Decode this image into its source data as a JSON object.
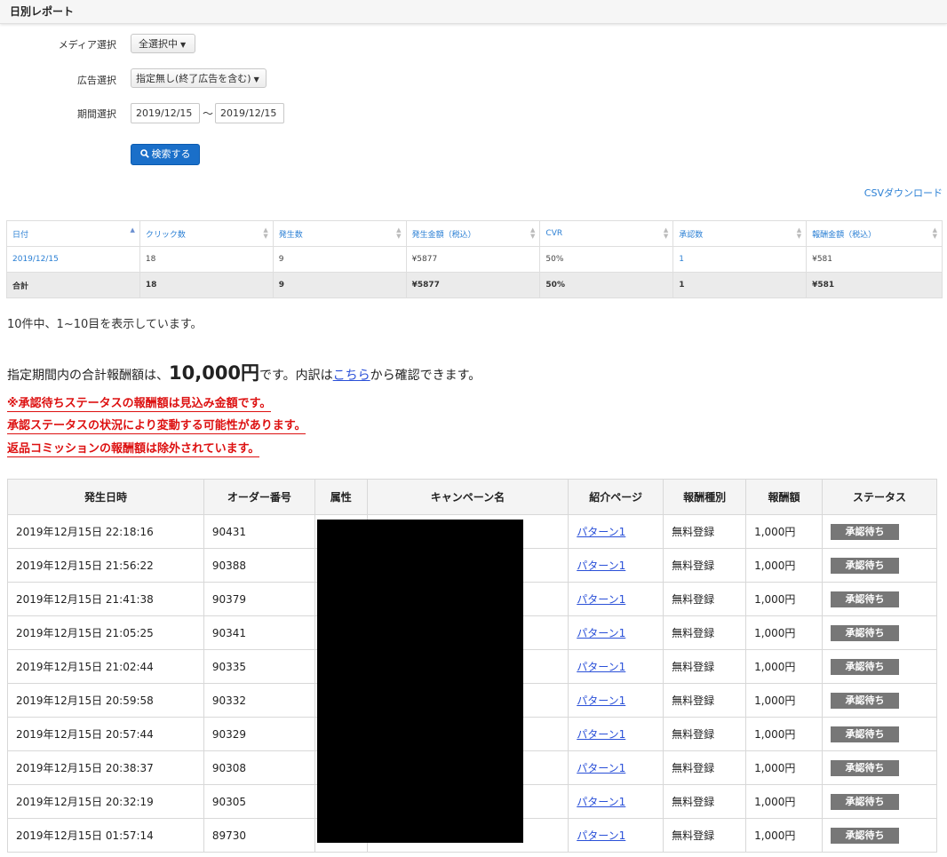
{
  "header": {
    "title": "日別レポート"
  },
  "filters": {
    "media_label": "メディア選択",
    "media_value": "全選択中",
    "ad_label": "広告選択",
    "ad_value": "指定無し(終了広告を含む)",
    "period_label": "期間選択",
    "date_from": "2019/12/15",
    "date_separator": "〜",
    "date_to": "2019/12/15",
    "search_button": "検索する"
  },
  "csv_link": "CSVダウンロード",
  "summary_table": {
    "headers": [
      "日付",
      "クリック数",
      "発生数",
      "発生金額（税込）",
      "CVR",
      "承認数",
      "報酬金額（税込）"
    ],
    "rows": [
      [
        "2019/12/15",
        "18",
        "9",
        "¥5877",
        "50%",
        "1",
        "¥581"
      ]
    ],
    "total": [
      "合計",
      "18",
      "9",
      "¥5877",
      "50%",
      "1",
      "¥581"
    ]
  },
  "count_text": "10件中、1~10目を表示しています。",
  "total_text": {
    "prefix": "指定期間内の合計報酬額は、",
    "amount": "10,000円",
    "middle": "です。内訳は",
    "link": "こちら",
    "suffix": "から確認できます。"
  },
  "warnings": [
    "※承認待ちステータスの報酬額は見込み金額です。",
    "承認ステータスの状況により変動する可能性があります。",
    "返品コミッションの報酬額は除外されています。"
  ],
  "orders_table": {
    "headers": [
      "発生日時",
      "オーダー番号",
      "属性",
      "キャンペーン名",
      "紹介ページ",
      "報酬種別",
      "報酬額",
      "ステータス"
    ],
    "rows": [
      {
        "date": "2019年12月15日 22:18:16",
        "order": "90431",
        "page": "パターン1",
        "type": "無料登録",
        "amount": "1,000円",
        "status": "承認待ち"
      },
      {
        "date": "2019年12月15日 21:56:22",
        "order": "90388",
        "page": "パターン1",
        "type": "無料登録",
        "amount": "1,000円",
        "status": "承認待ち"
      },
      {
        "date": "2019年12月15日 21:41:38",
        "order": "90379",
        "page": "パターン1",
        "type": "無料登録",
        "amount": "1,000円",
        "status": "承認待ち"
      },
      {
        "date": "2019年12月15日 21:05:25",
        "order": "90341",
        "page": "パターン1",
        "type": "無料登録",
        "amount": "1,000円",
        "status": "承認待ち"
      },
      {
        "date": "2019年12月15日 21:02:44",
        "order": "90335",
        "page": "パターン1",
        "type": "無料登録",
        "amount": "1,000円",
        "status": "承認待ち"
      },
      {
        "date": "2019年12月15日 20:59:58",
        "order": "90332",
        "page": "パターン1",
        "type": "無料登録",
        "amount": "1,000円",
        "status": "承認待ち"
      },
      {
        "date": "2019年12月15日 20:57:44",
        "order": "90329",
        "page": "パターン1",
        "type": "無料登録",
        "amount": "1,000円",
        "status": "承認待ち"
      },
      {
        "date": "2019年12月15日 20:38:37",
        "order": "90308",
        "page": "パターン1",
        "type": "無料登録",
        "amount": "1,000円",
        "status": "承認待ち"
      },
      {
        "date": "2019年12月15日 20:32:19",
        "order": "90305",
        "page": "パターン1",
        "type": "無料登録",
        "amount": "1,000円",
        "status": "承認待ち"
      },
      {
        "date": "2019年12月15日 01:57:14",
        "order": "89730",
        "page": "パターン1",
        "type": "無料登録",
        "amount": "1,000円",
        "status": "承認待ち"
      }
    ]
  },
  "colors": {
    "accent": "#1a6fc9",
    "link": "#2a7fd4",
    "warning": "#dd1111",
    "status_badge": "#777777"
  }
}
